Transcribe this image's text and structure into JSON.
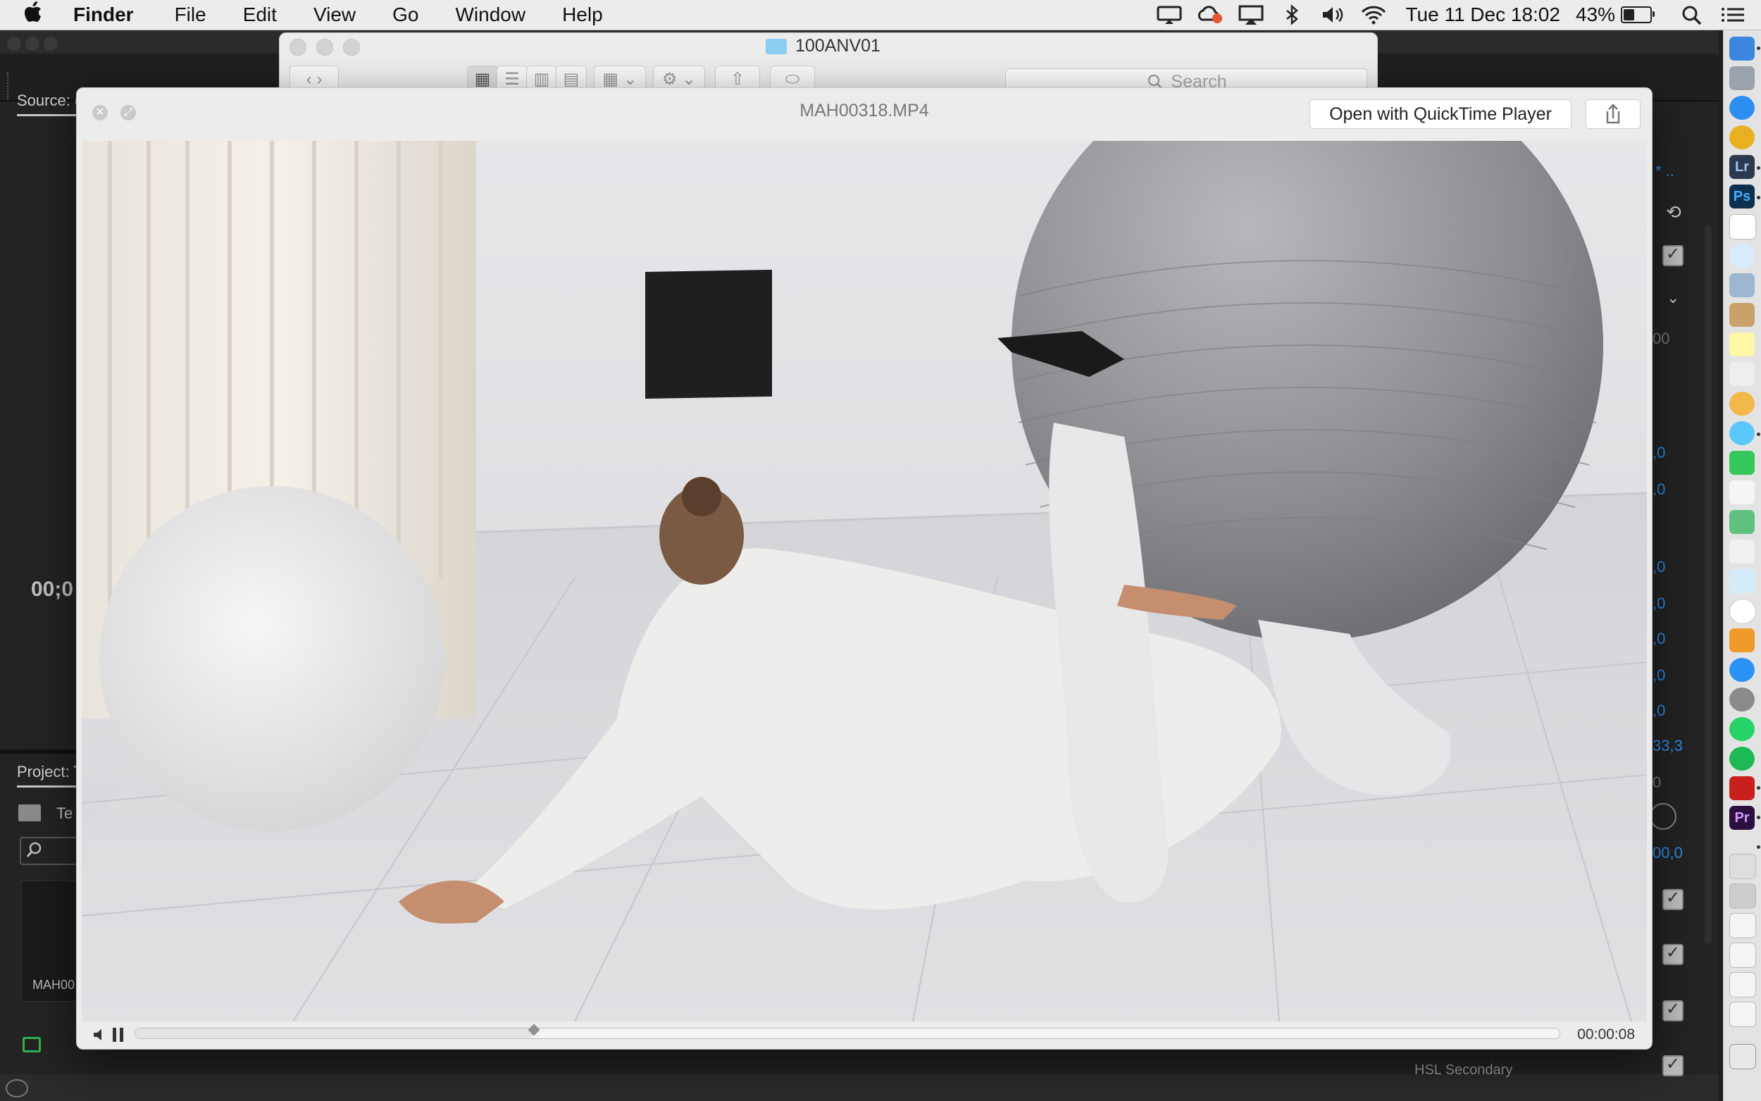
{
  "menubar": {
    "app": "Finder",
    "menus": [
      "File",
      "Edit",
      "View",
      "Go",
      "Window",
      "Help"
    ],
    "clock": "Tue 11 Dec  18:02",
    "battery_percent": "43%",
    "battery_level": 0.43,
    "status_icons": [
      "monitor-icon",
      "creative-cloud-icon",
      "airplay-icon",
      "bluetooth-icon",
      "volume-icon",
      "wifi-icon"
    ]
  },
  "finder": {
    "title": "100ANV01",
    "search_placeholder": "Search"
  },
  "quicklook": {
    "title": "MAH00318.MP4",
    "open_button": "Open with QuickTime Player",
    "time": "00:00:08",
    "progress": 0.28
  },
  "premiere": {
    "source_tab": "Source: (",
    "source_time": "00;0",
    "project_tab": "Project: T",
    "project_item": "Te",
    "clip_name": "MAH00",
    "right_panel": {
      "title": "* ..",
      "values": [
        ",0",
        ",0",
        ",0",
        ",0",
        ",0",
        ",0",
        ",0",
        "33,3",
        "00,0"
      ],
      "gray": [
        "00",
        "0"
      ],
      "bottom_label": "HSL Secondary"
    }
  },
  "dock": {
    "labels": [
      "Lr",
      "Ps",
      "Pr"
    ]
  },
  "colors": {
    "accent": "#2d8ceb",
    "premiere_bg": "#232323",
    "menubar_bg": "#ececec"
  }
}
